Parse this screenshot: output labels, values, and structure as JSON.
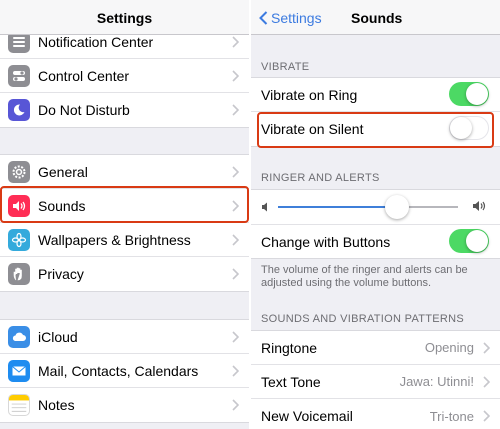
{
  "colors": {
    "accent": "#3c7be0",
    "toggle_on": "#4cd964",
    "highlight": "#d93a14"
  },
  "settings": {
    "title": "Settings",
    "groups": [
      [
        {
          "label": "Notification Center",
          "icon": "notification-center-icon",
          "icon_color": "#8e8e93"
        },
        {
          "label": "Control Center",
          "icon": "control-center-icon",
          "icon_color": "#8e8e93"
        },
        {
          "label": "Do Not Disturb",
          "icon": "moon-icon",
          "icon_color": "#5856d6"
        }
      ],
      [
        {
          "label": "General",
          "icon": "gear-icon",
          "icon_color": "#8e8e93"
        },
        {
          "label": "Sounds",
          "icon": "speaker-icon",
          "icon_color": "#ff2d55"
        },
        {
          "label": "Wallpapers & Brightness",
          "icon": "flower-icon",
          "icon_color": "#34aadc"
        },
        {
          "label": "Privacy",
          "icon": "hand-icon",
          "icon_color": "#8e8e93"
        }
      ],
      [
        {
          "label": "iCloud",
          "icon": "cloud-icon",
          "icon_color": "#3a8ee6"
        },
        {
          "label": "Mail, Contacts, Calendars",
          "icon": "mail-icon",
          "icon_color": "#1e8cf0"
        },
        {
          "label": "Notes",
          "icon": "notes-icon",
          "icon_color": "#ffcc00"
        }
      ]
    ]
  },
  "sounds": {
    "back_label": "Settings",
    "title": "Sounds",
    "vibrate_header": "VIBRATE",
    "vibrate_on_ring": {
      "label": "Vibrate on Ring",
      "on": true
    },
    "vibrate_on_silent": {
      "label": "Vibrate on Silent",
      "on": false
    },
    "ringer_header": "RINGER AND ALERTS",
    "ringer_volume": 0.63,
    "change_with_buttons": {
      "label": "Change with Buttons",
      "on": true
    },
    "ringer_footnote": "The volume of the ringer and alerts can be adjusted using the volume buttons.",
    "patterns_header": "SOUNDS AND VIBRATION PATTERNS",
    "patterns": [
      {
        "label": "Ringtone",
        "value": "Opening"
      },
      {
        "label": "Text Tone",
        "value": "Jawa: Utinni!"
      },
      {
        "label": "New Voicemail",
        "value": "Tri-tone"
      }
    ]
  }
}
